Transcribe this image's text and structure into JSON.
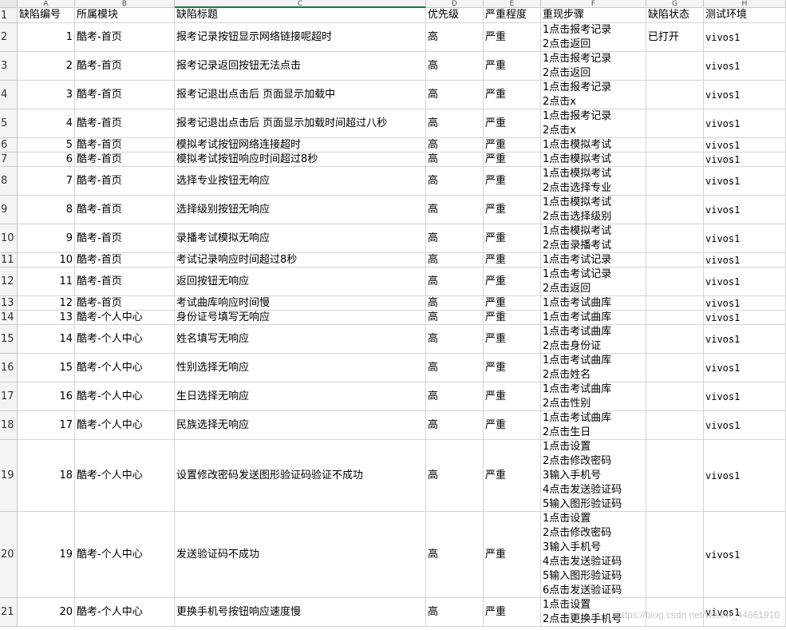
{
  "column_letters": [
    "A",
    "B",
    "C",
    "D",
    "E",
    "F",
    "G",
    "H"
  ],
  "headers": [
    "缺陷编号",
    "所属模块",
    "缺陷标题",
    "优先级",
    "严重程度",
    "重现步骤",
    "缺陷状态",
    "测试环境"
  ],
  "rows": [
    {
      "row": "2",
      "id": "1",
      "module": "酷考-首页",
      "title": "报考记录按钮显示网络链接呢超时",
      "priority": "高",
      "severity": "严重",
      "steps": "1点击报考记录\n2点击返回",
      "status": "已打开",
      "env": "vivos1"
    },
    {
      "row": "3",
      "id": "2",
      "module": "酷考-首页",
      "title": "报考记录返回按钮无法点击",
      "priority": "高",
      "severity": "严重",
      "steps": "1点击报考记录\n2点击返回",
      "status": "",
      "env": "vivos1"
    },
    {
      "row": "4",
      "id": "3",
      "module": "酷考-首页",
      "title": "报考记退出点击后 页面显示加载中",
      "priority": "高",
      "severity": "严重",
      "steps": "1点击报考记录\n2点击x",
      "status": "",
      "env": "vivos1"
    },
    {
      "row": "5",
      "id": "4",
      "module": "酷考-首页",
      "title": "报考记退出点击后 页面显示加载时间超过八秒",
      "priority": "高",
      "severity": "严重",
      "steps": "1点击报考记录\n2点击x",
      "status": "",
      "env": "vivos1"
    },
    {
      "row": "6",
      "id": "5",
      "module": "酷考-首页",
      "title": "模拟考试按钮网络连接超时",
      "priority": "高",
      "severity": "严重",
      "steps": "1点击模拟考试",
      "status": "",
      "env": "vivos1"
    },
    {
      "row": "7",
      "id": "6",
      "module": "酷考-首页",
      "title": "模拟考试按钮响应时间超过8秒",
      "priority": "高",
      "severity": "严重",
      "steps": "1点击模拟考试",
      "status": "",
      "env": "vivos1"
    },
    {
      "row": "8",
      "id": "7",
      "module": "酷考-首页",
      "title": "选择专业按钮无响应",
      "priority": "高",
      "severity": "严重",
      "steps": "1点击模拟考试\n2点击选择专业",
      "status": "",
      "env": "vivos1"
    },
    {
      "row": "9",
      "id": "8",
      "module": "酷考-首页",
      "title": "选择级别按钮无响应",
      "priority": "高",
      "severity": "严重",
      "steps": "1点击模拟考试\n2点击选择级别",
      "status": "",
      "env": "vivos1"
    },
    {
      "row": "10",
      "id": "9",
      "module": "酷考-首页",
      "title": "录播考试模拟无响应",
      "priority": "高",
      "severity": "严重",
      "steps": "1点击模拟考试\n2点击录播考试",
      "status": "",
      "env": "vivos1"
    },
    {
      "row": "11",
      "id": "10",
      "module": "酷考-首页",
      "title": "考试记录响应时间超过8秒",
      "priority": "高",
      "severity": "严重",
      "steps": "1点击考试记录",
      "status": "",
      "env": "vivos1"
    },
    {
      "row": "12",
      "id": "11",
      "module": "酷考-首页",
      "title": "返回按钮无响应",
      "priority": "高",
      "severity": "严重",
      "steps": "1点击考试记录\n2点击返回",
      "status": "",
      "env": "vivos1"
    },
    {
      "row": "13",
      "id": "12",
      "module": "酷考-首页",
      "title": "考试曲库响应时间慢",
      "priority": "高",
      "severity": "严重",
      "steps": "1点击考试曲库",
      "status": "",
      "env": "vivos1"
    },
    {
      "row": "14",
      "id": "13",
      "module": "酷考-个人中心",
      "title": "身份证号填写无响应",
      "priority": "高",
      "severity": "严重",
      "steps": "1点击考试曲库",
      "status": "",
      "env": "vivos1"
    },
    {
      "row": "15",
      "id": "14",
      "module": "酷考-个人中心",
      "title": "姓名填写无响应",
      "priority": "高",
      "severity": "严重",
      "steps": "1点击考试曲库\n2点击身份证",
      "status": "",
      "env": "vivos1"
    },
    {
      "row": "16",
      "id": "15",
      "module": "酷考-个人中心",
      "title": "性别选择无响应",
      "priority": "高",
      "severity": "严重",
      "steps": "1点击考试曲库\n2点击姓名",
      "status": "",
      "env": "vivos1"
    },
    {
      "row": "17",
      "id": "16",
      "module": "酷考-个人中心",
      "title": "生日选择无响应",
      "priority": "高",
      "severity": "严重",
      "steps": "1点击考试曲库\n2点击性别",
      "status": "",
      "env": "vivos1"
    },
    {
      "row": "18",
      "id": "17",
      "module": "酷考-个人中心",
      "title": "民族选择无响应",
      "priority": "高",
      "severity": "严重",
      "steps": "1点击考试曲库\n2点击生日",
      "status": "",
      "env": "vivos1"
    },
    {
      "row": "19",
      "id": "18",
      "module": "酷考-个人中心",
      "title": "设置修改密码发送图形验证码验证不成功",
      "priority": "高",
      "severity": "严重",
      "steps": "1点击设置\n2点击修改密码\n3输入手机号\n4点击发送验证码\n5输入图形验证码",
      "status": "",
      "env": "vivos1"
    },
    {
      "row": "20",
      "id": "19",
      "module": "酷考-个人中心",
      "title": "发送验证码不成功",
      "priority": "高",
      "severity": "严重",
      "steps": "1点击设置\n2点击修改密码\n3输入手机号\n4点击发送验证码\n5输入图形验证码\n6点击发送验证码",
      "status": "",
      "env": "vivos1"
    },
    {
      "row": "21",
      "id": "20",
      "module": "酷考-个人中心",
      "title": "更换手机号按钮响应速度慢",
      "priority": "高",
      "severity": "严重",
      "steps": "1点击设置\n2点击更换手机号",
      "status": "",
      "env": "vivos1"
    }
  ],
  "watermark": "https://blog.csdn.net/weixin_44861910"
}
